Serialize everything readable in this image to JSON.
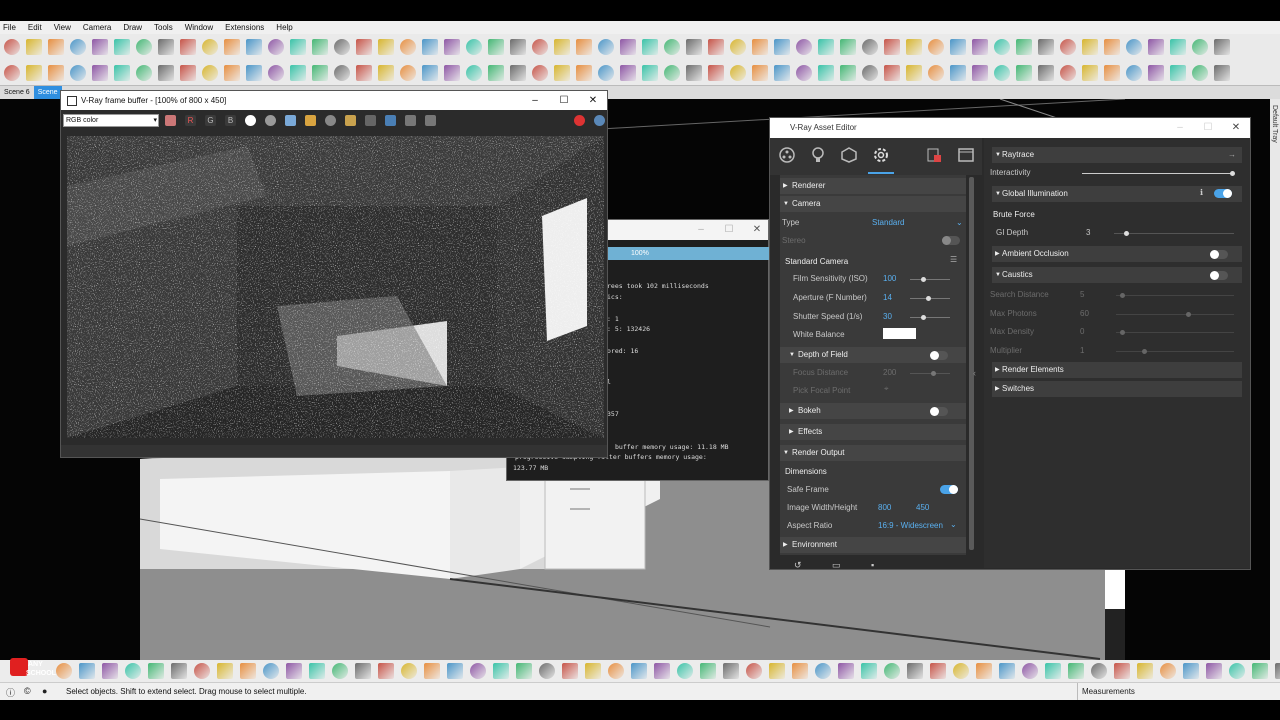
{
  "menu": [
    "File",
    "Edit",
    "View",
    "Camera",
    "Draw",
    "Tools",
    "Window",
    "Extensions",
    "Help"
  ],
  "scenes": [
    "Scene 6",
    "Scene"
  ],
  "status": {
    "message": "Select objects. Shift to extend select. Drag mouse to select multiple.",
    "measurements_label": "Measurements"
  },
  "right_tray_label": "Default Tray",
  "logo_text": "ANY SCHOOL",
  "vfb": {
    "title": "V-Ray frame buffer - [100% of 800 x 450]",
    "channel": "RGB color",
    "channel_buttons": [
      "R",
      "G",
      "B"
    ]
  },
  "log": {
    "progress": "100%",
    "lines": [
      "rees took 102 milliseconds",
      "ics:",
      ": 1",
      ": 5: 132426",
      "ored: 16",
      "l",
      "357",
      "buffer memory usage: 11.18 MB",
      "progressive sampling filter buffers memory usage:",
      "123.77 MB"
    ]
  },
  "asset_editor": {
    "title": "V-Ray Asset Editor",
    "settings": {
      "renderer": "Renderer",
      "camera": "Camera",
      "type_label": "Type",
      "type_value": "Standard",
      "stereo_label": "Stereo",
      "standard_camera": "Standard Camera",
      "iso_label": "Film Sensitivity (ISO)",
      "iso_value": "100",
      "aperture_label": "Aperture (F Number)",
      "aperture_value": "14",
      "shutter_label": "Shutter Speed (1/s)",
      "shutter_value": "30",
      "wb_label": "White Balance",
      "dof": "Depth of Field",
      "focus_label": "Focus Distance",
      "focus_value": "200",
      "pick_label": "Pick Focal Point",
      "bokeh": "Bokeh",
      "effects": "Effects",
      "render_output": "Render Output",
      "dimensions": "Dimensions",
      "safe_frame": "Safe Frame",
      "size_label": "Image Width/Height",
      "width": "800",
      "height": "450",
      "aspect_label": "Aspect Ratio",
      "aspect_value": "16:9 - Widescreen",
      "environment": "Environment"
    },
    "right": {
      "raytrace": "Raytrace",
      "interactivity": "Interactivity",
      "gi": "Global Illumination",
      "brute_force": "Brute Force",
      "gi_depth_label": "GI Depth",
      "gi_depth_value": "3",
      "ao": "Ambient Occlusion",
      "caustics": "Caustics",
      "search_label": "Search Distance",
      "search_value": "5",
      "photons_label": "Max Photons",
      "photons_value": "60",
      "density_label": "Max Density",
      "density_value": "0",
      "mult_label": "Multiplier",
      "mult_value": "1",
      "render_elements": "Render Elements",
      "switches": "Switches"
    }
  },
  "colors": {
    "accent": "#4aa3e8",
    "value_text": "#5ab0f0",
    "scene_tab_active": "#2f8fe0"
  }
}
